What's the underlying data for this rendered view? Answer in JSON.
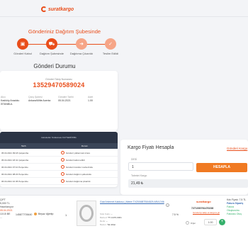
{
  "brand": {
    "name": "suratkargo",
    "color": "#e94e1b"
  },
  "page": {
    "heading": "Gönderiniz Dağıtım Şubesinde",
    "status_title": "Gönderi Durumu"
  },
  "steps": [
    {
      "label": "Gönderi Kabul",
      "icon": "box-icon",
      "state": "done"
    },
    {
      "label": "Dağıtım Şubesinde",
      "icon": "truck-icon",
      "state": "done"
    },
    {
      "label": "Dağıtıma Çıkarıldı",
      "icon": "route-icon",
      "state": "pending"
    },
    {
      "label": "Teslim Edildi",
      "icon": "check-icon",
      "state": "pending"
    }
  ],
  "tracking": {
    "label": "Gönderi Takip Numarası",
    "number": "13529470589024",
    "columns": [
      {
        "label": "Alıcı",
        "value": "Kadıköy Anadolu",
        "value2": "İSTANBUL"
      },
      {
        "label": "Çıkış Şubesi",
        "value": "Ankara/Mitte Acenta"
      },
      {
        "label": "Gönderi Tarihi",
        "value": "05.04.2021"
      },
      {
        "label": "Adet",
        "value": "1.00"
      }
    ]
  },
  "movements": {
    "header": "Hareketler Sıralaması KAYSERİ/KBA",
    "col_date": "Tarih",
    "col_status": "Durum",
    "rows": [
      {
        "date": "05.04.2021 09:18 Çarşamba",
        "text": "Gönderi yüklenmek üzere"
      },
      {
        "date": "05.04.2021 18:41 Çarşamba",
        "text": "Gönderi kabul edildi"
      },
      {
        "date": "06.04.2021 07:10 Perşembe",
        "text": "Gönderi transfer merkezinde"
      },
      {
        "date": "06.04.2021 08:23 Perşembe",
        "text": "Gönderi dağıtım şubesinde"
      },
      {
        "date": "06.04.2021 10:45 Perşembe",
        "text": "Gönderi dağıtıma çıkarıldı"
      }
    ]
  },
  "calculator": {
    "title": "Kargo Fiyatı Hesapla",
    "link": "Gönderi Kargo",
    "desi_label": "DESİ",
    "desi_value": "1",
    "button": "HESAPLA",
    "result_label": "Tahmini Kargo",
    "result_value": "21,49 ₺"
  },
  "order": {
    "left": [
      "ÇIFT",
      "5,000 TL",
      "Hazırlanıyor",
      "05.04.2021",
      "13:15 BE",
      "..."
    ],
    "left_highlight": "05.04.2021",
    "code": "145877705440",
    "status": "Beyaz öğretip",
    "qty": "1",
    "product_title": "Gold İnternet Kablosu | Metre TVZ006BTB04525 ARA D06",
    "meta": [
      {
        "k": "Stok Kodu:",
        "v": "--"
      },
      {
        "k": "Barkod:",
        "v": "TT-CAT6-0001"
      },
      {
        "k": "Renk:",
        "v": "--"
      },
      {
        "k": "Beden:",
        "v": "Tek Ebat"
      }
    ],
    "percent": "7.5 %",
    "cargo_brand": "suratkargo",
    "cargo_code": "7271000761470238",
    "cargo_link": "Gönderiyi takip et kargo'a git",
    "radio_label": "Diğer",
    "price": "1.00",
    "right": [
      "Kdv Fiyatı: 7.5 TL",
      "Fatura Sipariş",
      "",
      "Fatura",
      "Oluşturuldu",
      "Faturası Oluş"
    ]
  }
}
